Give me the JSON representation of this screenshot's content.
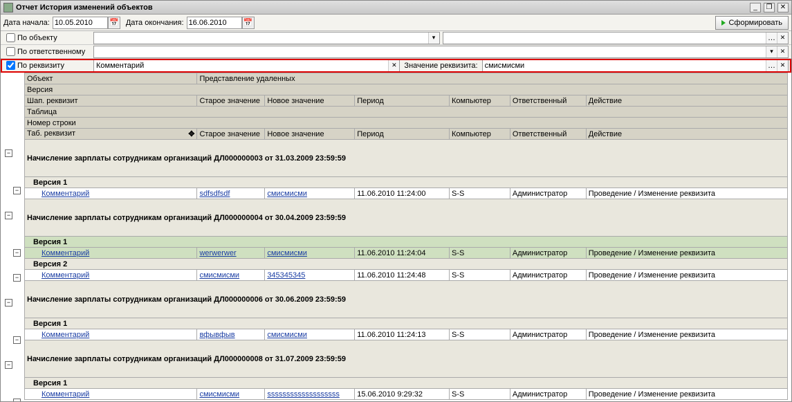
{
  "title": "Отчет  История изменений объектов",
  "labels": {
    "date_start": "Дата начала:",
    "date_end": "Дата окончания:",
    "by_object": "По объекту",
    "by_responsible": "По ответственному",
    "by_requisite": "По реквизиту",
    "value_of_requisite": "Значение реквизита:",
    "generate": "Сформировать"
  },
  "filters": {
    "date_start": "10.05.2010",
    "date_end": "16.06.2010",
    "by_object_checked": false,
    "by_object_value": "",
    "by_object_value2": "",
    "by_responsible_checked": false,
    "by_responsible_value": "",
    "by_requisite_checked": true,
    "by_requisite_value": "Комментарий",
    "by_requisite_value2": "смисмисми"
  },
  "headers": {
    "object": "Объект",
    "deleted_representation": "Представление удаленных",
    "version": "Версия",
    "header_requisite": "Шап. реквизит",
    "old_value": "Старое значение",
    "new_value": "Новое значение",
    "period": "Период",
    "computer": "Компьютер",
    "responsible": "Ответственный",
    "action": "Действие",
    "table": "Таблица",
    "row_number": "Номер строки",
    "tab_requisite": "Таб. реквизит"
  },
  "groups": [
    {
      "object": "Начисление зарплаты сотрудникам организаций ДЛ000000003 от 31.03.2009 23:59:59",
      "versions": [
        {
          "name": "Версия 1",
          "selected": false,
          "rows": [
            {
              "req": "Комментарий",
              "old": "sdfsdfsdf",
              "new": "смисмисми",
              "period": "11.06.2010 11:24:00",
              "computer": "S-S",
              "responsible": "Администратор",
              "action": "Проведение / Изменение реквизита"
            }
          ]
        }
      ]
    },
    {
      "object": "Начисление зарплаты сотрудникам организаций ДЛ000000004 от 30.04.2009 23:59:59",
      "versions": [
        {
          "name": "Версия 1",
          "selected": true,
          "rows": [
            {
              "req": "Комментарий",
              "old": "werwerwer",
              "new": "смисмисми",
              "period": "11.06.2010 11:24:04",
              "computer": "S-S",
              "responsible": "Администратор",
              "action": "Проведение / Изменение реквизита"
            }
          ]
        },
        {
          "name": "Версия 2",
          "selected": false,
          "rows": [
            {
              "req": "Комментарий",
              "old": "смисмисми",
              "new": "345345345",
              "period": "11.06.2010 11:24:48",
              "computer": "S-S",
              "responsible": "Администратор",
              "action": "Проведение / Изменение реквизита"
            }
          ]
        }
      ]
    },
    {
      "object": "Начисление зарплаты сотрудникам организаций ДЛ000000006 от 30.06.2009 23:59:59",
      "versions": [
        {
          "name": "Версия 1",
          "selected": false,
          "rows": [
            {
              "req": "Комментарий",
              "old": "вфывфыв",
              "new": "смисмисми",
              "period": "11.06.2010 11:24:13",
              "computer": "S-S",
              "responsible": "Администратор",
              "action": "Проведение / Изменение реквизита"
            }
          ]
        }
      ]
    },
    {
      "object": "Начисление зарплаты сотрудникам организаций ДЛ000000008 от 31.07.2009 23:59:59",
      "versions": [
        {
          "name": "Версия 1",
          "selected": false,
          "rows": [
            {
              "req": "Комментарий",
              "old": "смисмисми",
              "new": "sssssssssssssssssss",
              "period": "15.06.2010 9:29:32",
              "computer": "S-S",
              "responsible": "Администратор",
              "action": "Проведение / Изменение реквизита"
            }
          ]
        }
      ]
    }
  ]
}
